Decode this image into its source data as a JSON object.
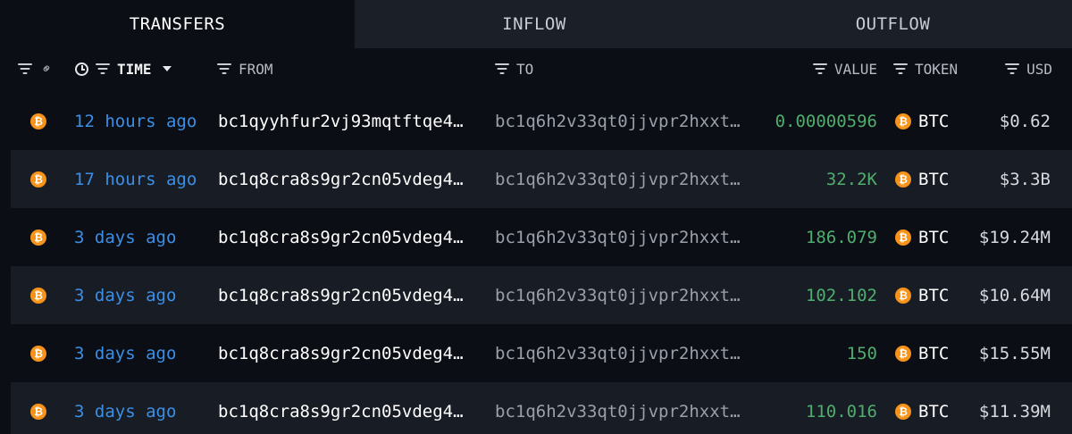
{
  "tabs": [
    {
      "label": "TRANSFERS"
    },
    {
      "label": "INFLOW"
    },
    {
      "label": "OUTFLOW"
    }
  ],
  "columns": {
    "time": "TIME",
    "from": "FROM",
    "to": "TO",
    "value": "VALUE",
    "token": "TOKEN",
    "usd": "USD"
  },
  "icons": {
    "token": "bitcoin-icon",
    "filter": "filter-icon",
    "link": "link-icon",
    "clock": "clock-icon",
    "sort": "caret-down-icon"
  },
  "colors": {
    "time": "#3b8fe6",
    "value": "#4fae6e",
    "btc": "#f7931a"
  },
  "rows": [
    {
      "time": "12 hours ago",
      "from": "bc1qyyhfur2vj93mqtftqe4…",
      "to": "bc1q6h2v33qt0jjvpr2hxxt…",
      "value": "0.00000596",
      "token": "BTC",
      "usd": "$0.62"
    },
    {
      "time": "17 hours ago",
      "from": "bc1q8cra8s9gr2cn05vdeg4…",
      "to": "bc1q6h2v33qt0jjvpr2hxxt…",
      "value": "32.2K",
      "token": "BTC",
      "usd": "$3.3B"
    },
    {
      "time": "3 days ago",
      "from": "bc1q8cra8s9gr2cn05vdeg4…",
      "to": "bc1q6h2v33qt0jjvpr2hxxt…",
      "value": "186.079",
      "token": "BTC",
      "usd": "$19.24M"
    },
    {
      "time": "3 days ago",
      "from": "bc1q8cra8s9gr2cn05vdeg4…",
      "to": "bc1q6h2v33qt0jjvpr2hxxt…",
      "value": "102.102",
      "token": "BTC",
      "usd": "$10.64M"
    },
    {
      "time": "3 days ago",
      "from": "bc1q8cra8s9gr2cn05vdeg4…",
      "to": "bc1q6h2v33qt0jjvpr2hxxt…",
      "value": "150",
      "token": "BTC",
      "usd": "$15.55M"
    },
    {
      "time": "3 days ago",
      "from": "bc1q8cra8s9gr2cn05vdeg4…",
      "to": "bc1q6h2v33qt0jjvpr2hxxt…",
      "value": "110.016",
      "token": "BTC",
      "usd": "$11.39M"
    }
  ]
}
